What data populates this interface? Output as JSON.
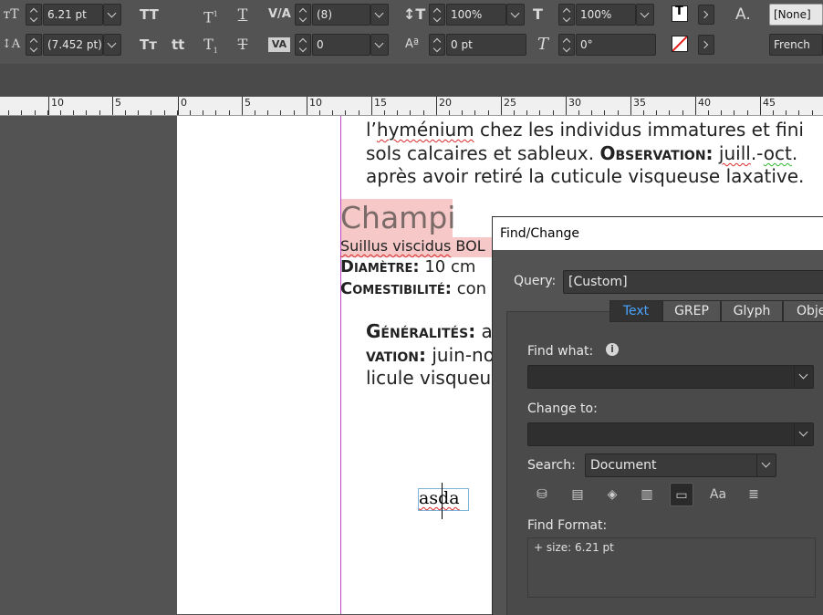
{
  "control_bar": {
    "row1": {
      "font_size": "6.21 pt",
      "kerning": "(8)",
      "vertical_scale": "100%",
      "horizontal_scale": "100%",
      "char_style": "[None]"
    },
    "row2": {
      "leading": "(7.452 pt)",
      "tracking": "0",
      "baseline_shift": "0 pt",
      "skew": "0°",
      "language": "French"
    }
  },
  "ruler": {
    "labels": [
      "10",
      "5",
      "0",
      "5",
      "10",
      "15",
      "20",
      "25",
      "30",
      "35",
      "40",
      "45"
    ]
  },
  "document": {
    "line1a": "l’",
    "line1b": "hyménium",
    "line1c": " chez les individus immatures et fini",
    "line2a": "sols calcaires et sableux. ",
    "line2b": "Observation:",
    "line2c": " ",
    "line2d": "juill",
    "line2e": ".-",
    "line2f": "oct",
    "line2g": ".",
    "line3": "après avoir retiré la cuticule visqueuse laxative.",
    "heading": "Champi",
    "species_a": "Suillus viscidus",
    "species_b": " BOL",
    "diametre_label": "Diamètre:",
    "diametre_value": " 10 cm",
    "comest_label": "Comestibilité:",
    "comest_value": " con",
    "gen_label": "Généralités:",
    "gen_value": " a",
    "obs_label": "vation:",
    "obs_value": " juin-no",
    "last_line": "licule visqueu",
    "cursor_word": "asda"
  },
  "dialog": {
    "title": "Find/Change",
    "query_label": "Query:",
    "query_value": "[Custom]",
    "tabs": [
      "Text",
      "GREP",
      "Glyph",
      "Obje"
    ],
    "find_what_label": "Find what:",
    "find_what_value": "",
    "change_to_label": "Change to:",
    "change_to_value": "",
    "search_label": "Search:",
    "search_value": "Document",
    "find_format_label": "Find Format:",
    "find_format_value": "+ size: 6.21 pt"
  }
}
